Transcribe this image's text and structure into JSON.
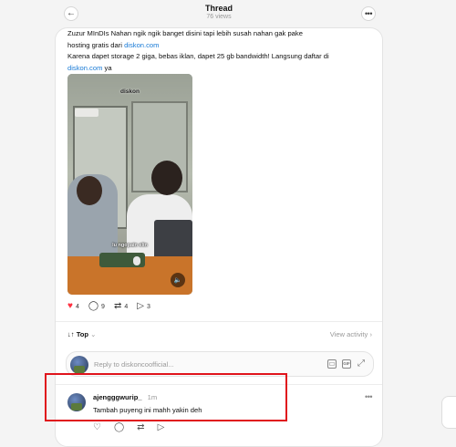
{
  "header": {
    "title": "Thread",
    "views": "76 views",
    "back_icon": "arrow-left-icon",
    "more_icon": "ellipsis-icon"
  },
  "post": {
    "text_line1": "Zuzur MInDIs Nahan ngik ngik banget disini tapi lebih susah nahan gak pake",
    "text_line2_prefix": "hosting gratis dari ",
    "text_line2_link": "diskon.com",
    "text_line3": "Karena dapet storage 2 giga, bebas iklan, dapet 25 gb bandwidth! Langsung daftar di",
    "text_line4_link": "diskon.com",
    "text_line4_suffix": " ya",
    "media": {
      "watermark": "diskon",
      "caption": "lu ngopain elin"
    },
    "stats": {
      "likes": "4",
      "comments": "9",
      "reposts": "4",
      "shares": "3"
    }
  },
  "sort": {
    "label": "Top",
    "view_activity": "View activity"
  },
  "reply": {
    "placeholder": "Reply to diskoncoofficial..."
  },
  "comment": {
    "username": "ajengggwurip_",
    "time": "1m",
    "text": "Tambah puyeng ini mahh yakin deh"
  },
  "colors": {
    "like_red": "#ff3040",
    "link_blue": "#1a7bd6",
    "highlight_red": "#e0141c"
  }
}
